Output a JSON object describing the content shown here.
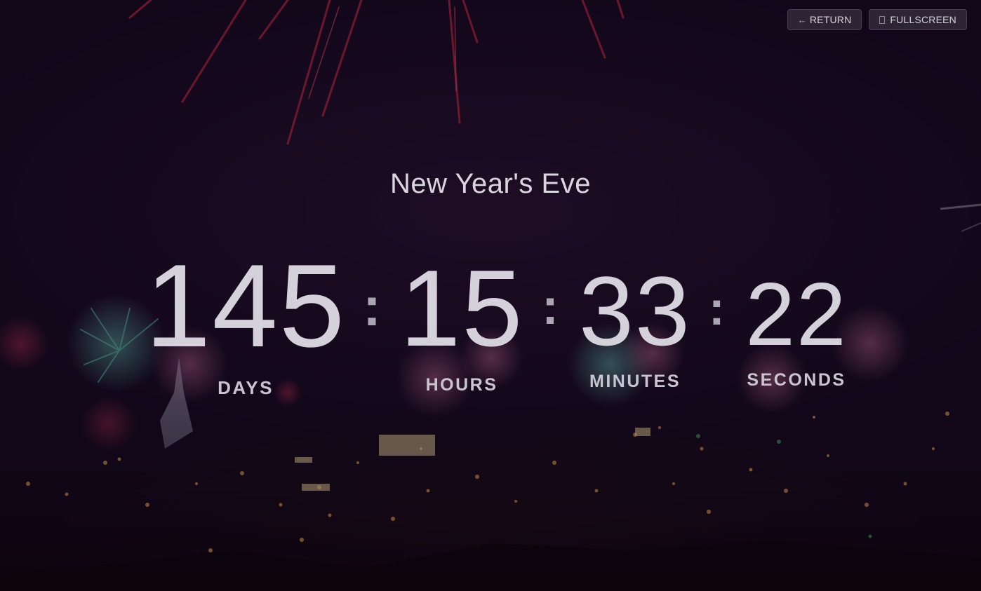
{
  "buttons": {
    "return_label": "RETURN",
    "return_icon": "←",
    "fullscreen_label": "FULLSCREEN"
  },
  "event": {
    "title": "New Year's Eve"
  },
  "countdown": {
    "days": "145",
    "days_label": "DAYS",
    "hours": "15",
    "hours_label": "HOURS",
    "minutes": "33",
    "minutes_label": "MINUTES",
    "seconds": "22",
    "seconds_label": "SECONDS",
    "separator": ":"
  },
  "colors": {
    "text": "#d4d1da",
    "background": "#160a1e"
  },
  "icons": {
    "return": "arrow-left-icon",
    "fullscreen": "fullscreen-icon"
  }
}
